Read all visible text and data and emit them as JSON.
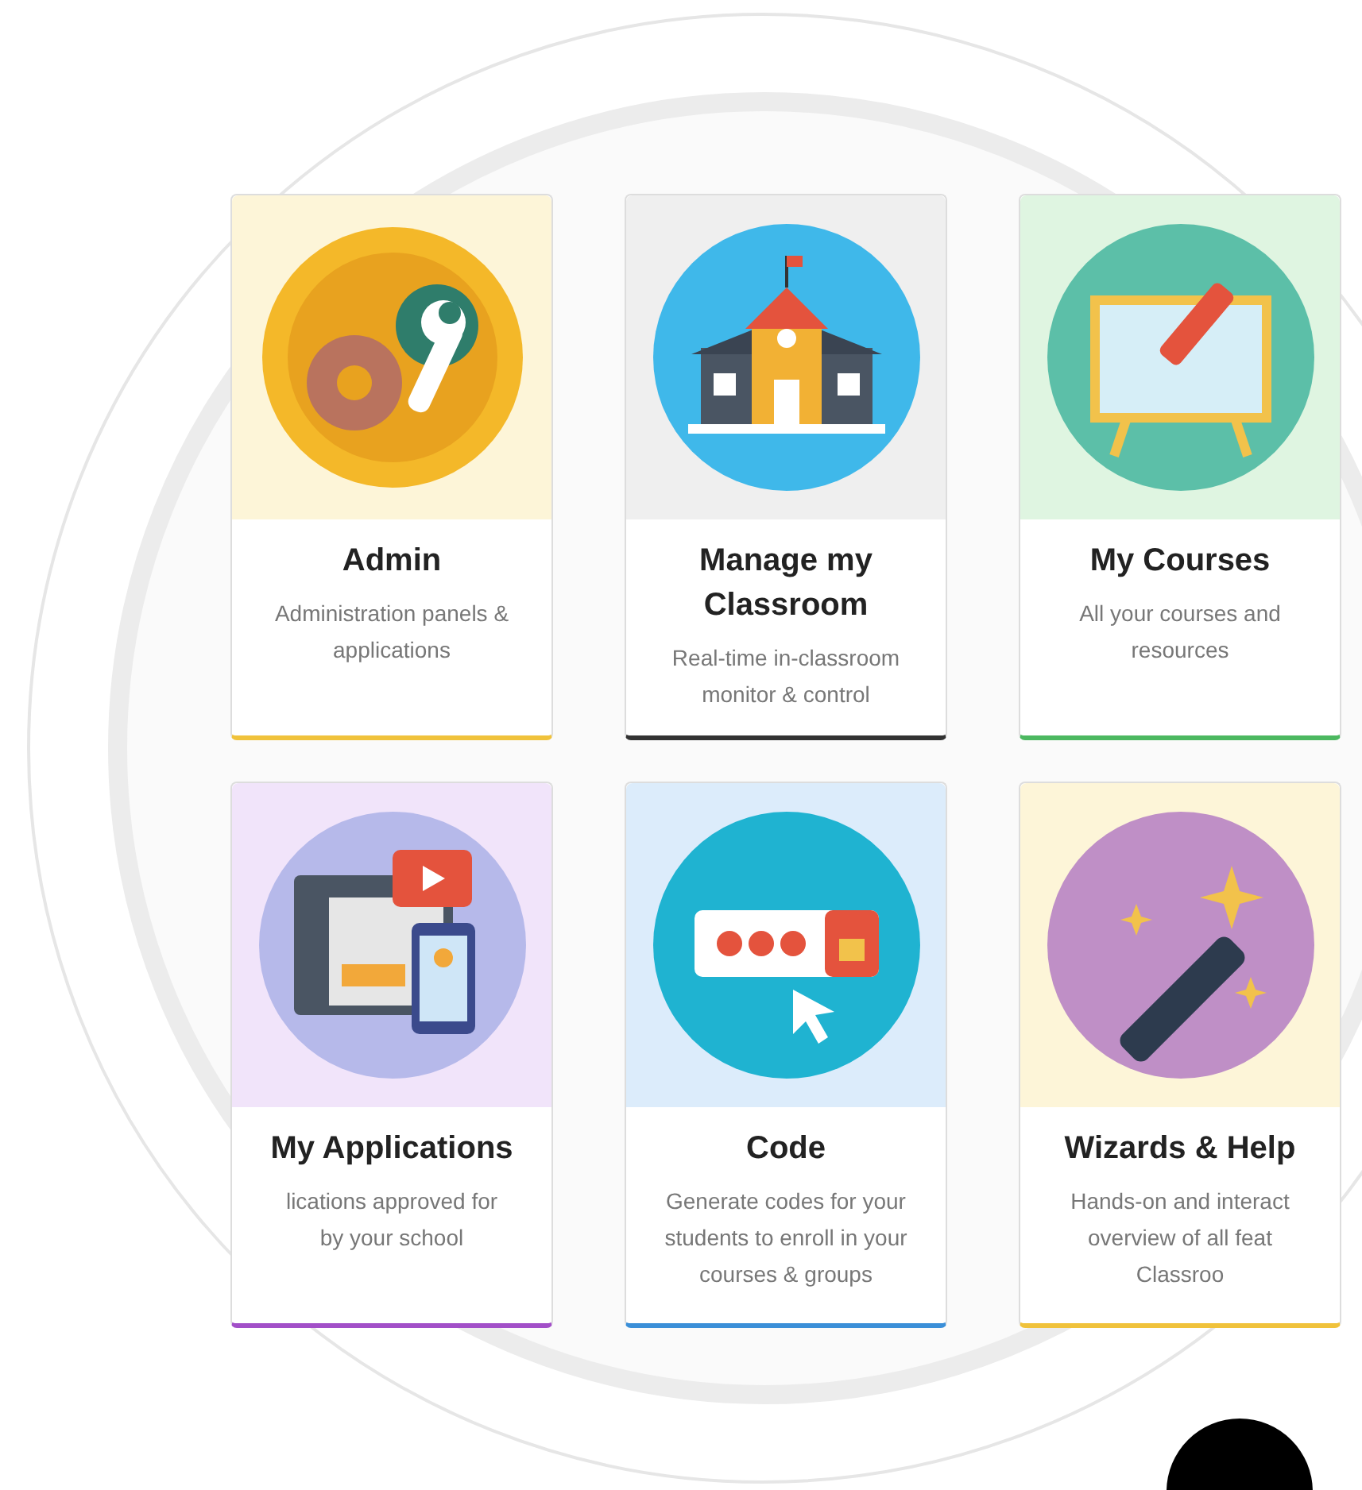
{
  "cards": [
    {
      "kind": "admin",
      "title": "Admin",
      "description_lines": [
        "Administration panels &",
        "applications"
      ],
      "color": "#f0c23b"
    },
    {
      "kind": "classroom",
      "title": "Manage my Classroom",
      "description_lines": [
        "Real-time in-classroom",
        "monitor & control"
      ],
      "color": "#333333"
    },
    {
      "kind": "courses",
      "title": "My Courses",
      "description_lines": [
        "All your courses and",
        "resources"
      ],
      "color": "#4cb860"
    },
    {
      "kind": "applications",
      "title": "My Applications",
      "description_lines": [
        "lications approved for",
        "by your school"
      ],
      "color": "#a24fc8"
    },
    {
      "kind": "code",
      "title": "Code",
      "description_lines": [
        "Generate codes for your",
        "students to enroll in your",
        "courses & groups"
      ],
      "color": "#3b8fd8"
    },
    {
      "kind": "wizards",
      "title": "Wizards & Help",
      "description_lines": [
        "Hands-on and interact",
        "overview of all feat",
        "Classroo"
      ],
      "color": "#f0c23b"
    }
  ]
}
